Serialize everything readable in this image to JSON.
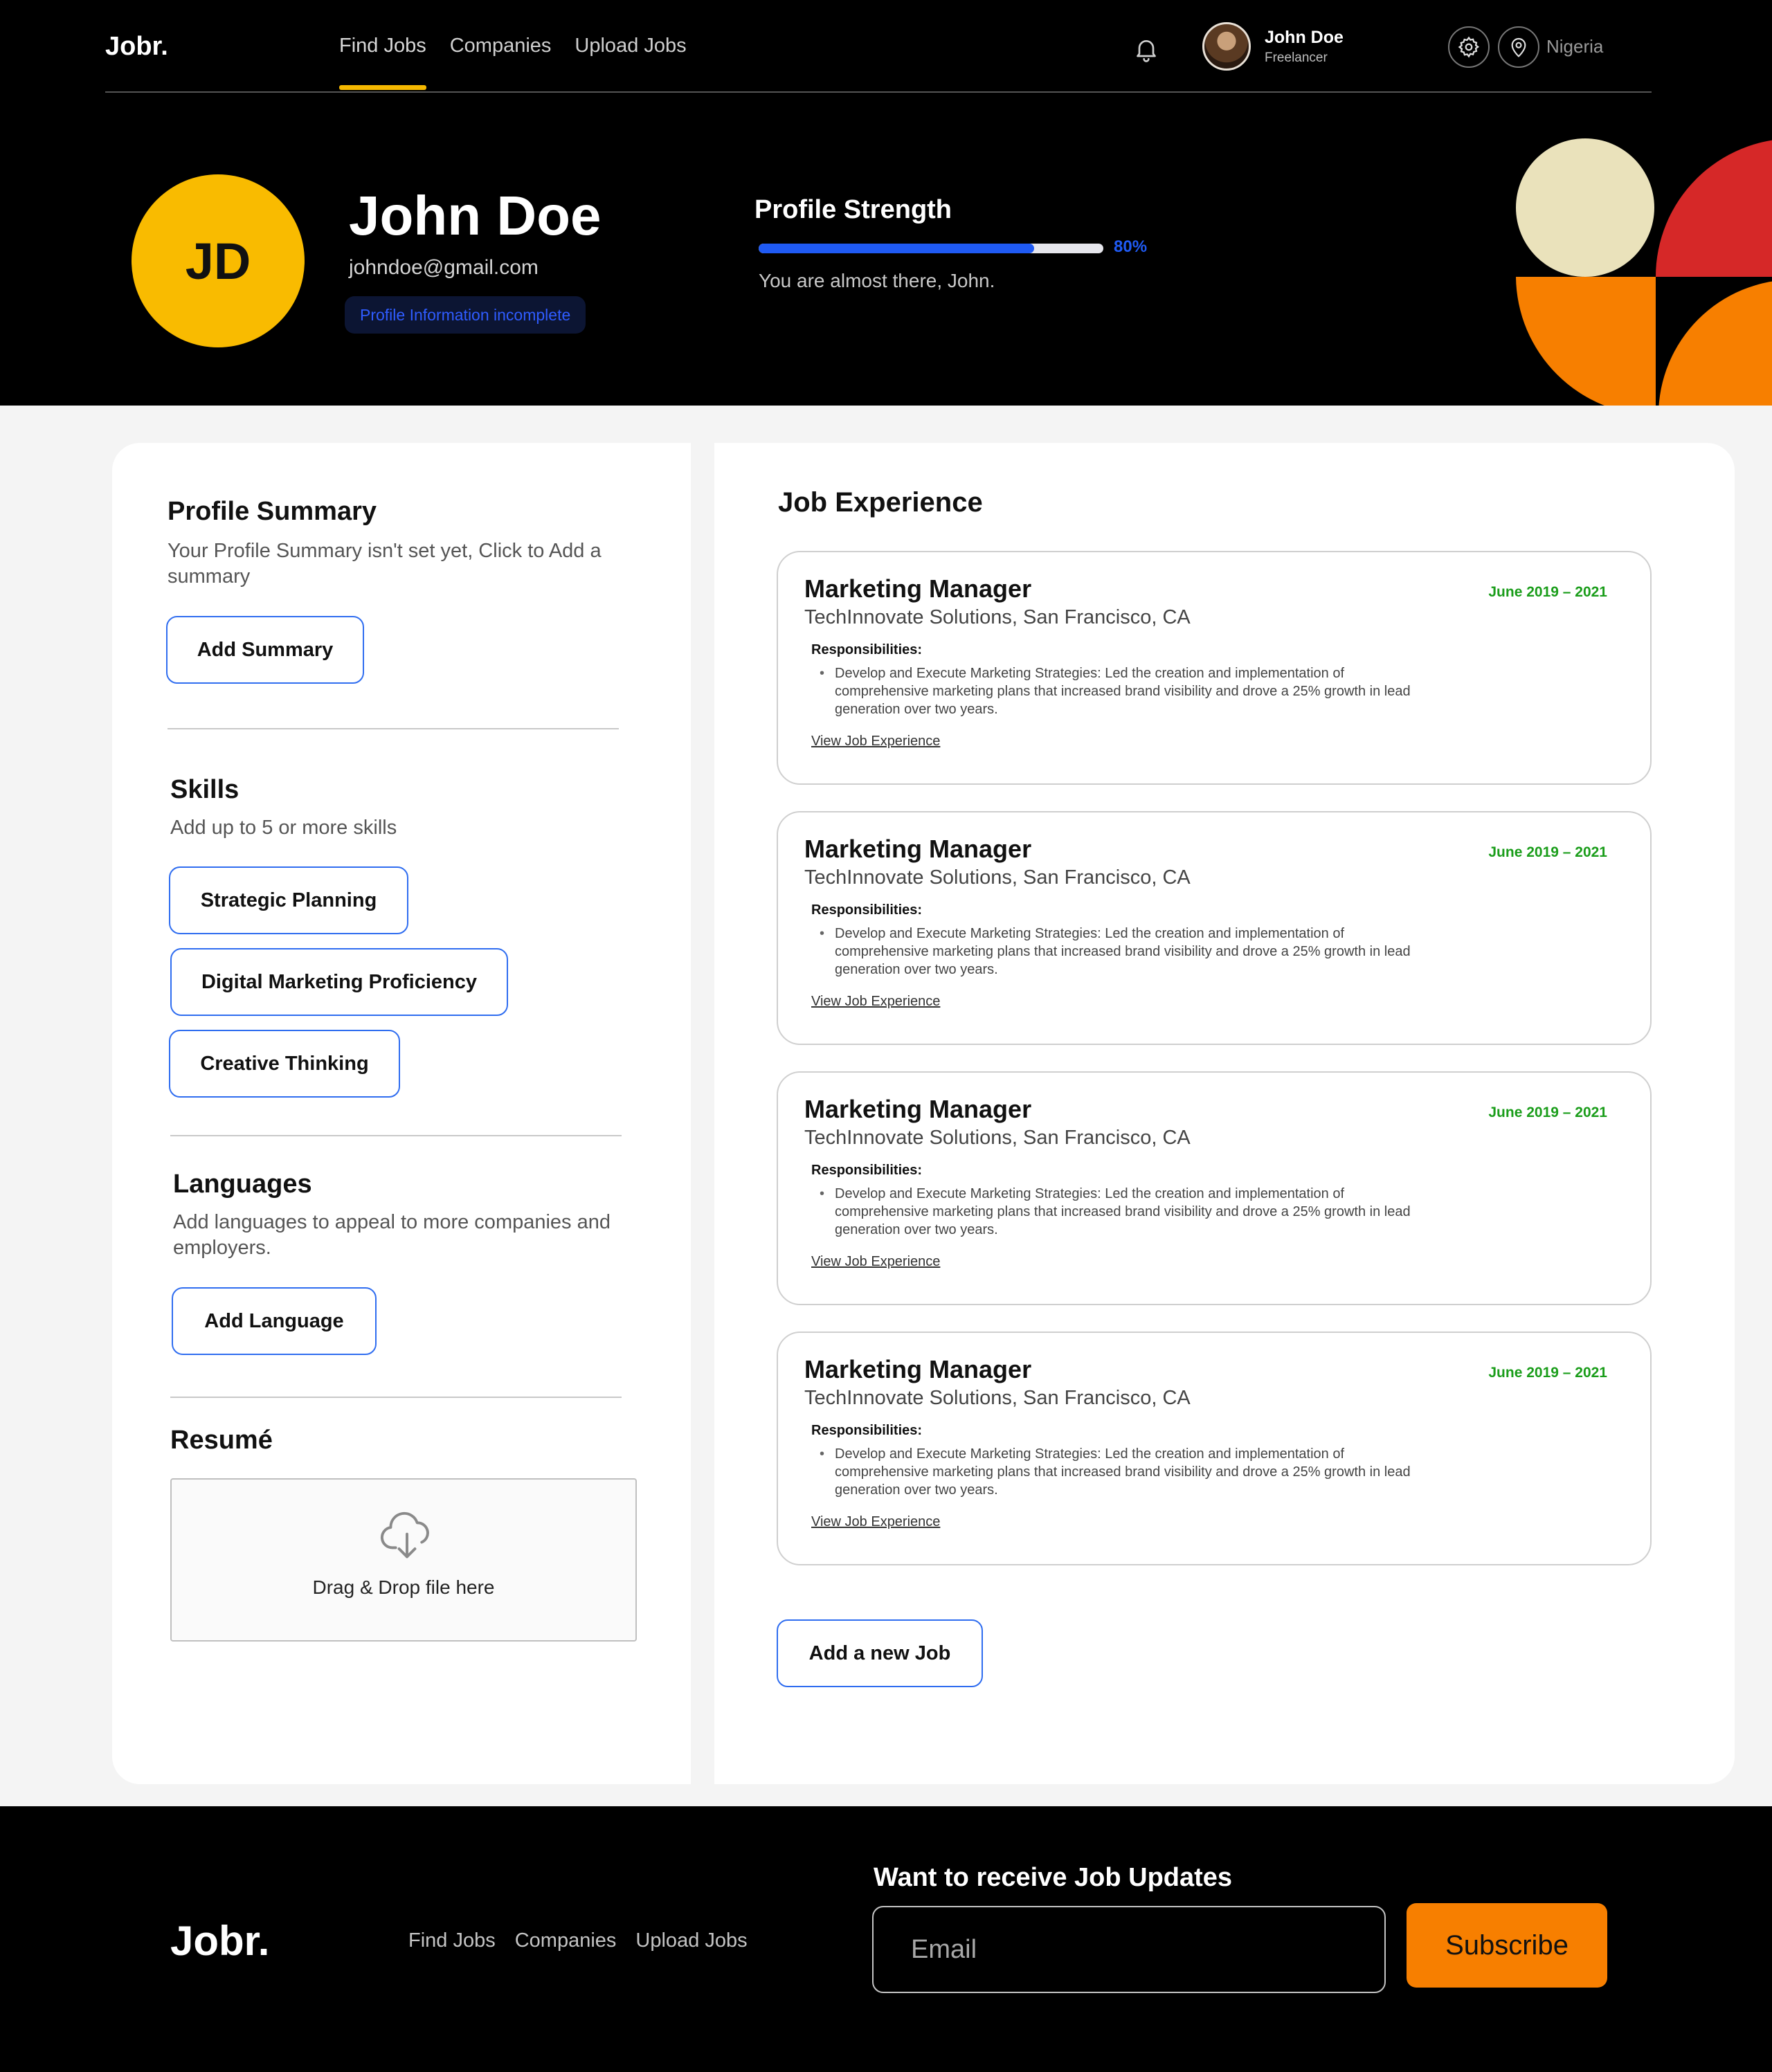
{
  "nav": {
    "logo": "Jobr.",
    "links": [
      "Find Jobs",
      "Companies",
      "Upload Jobs"
    ],
    "active_link": "Find Jobs",
    "user_name": "John Doe",
    "user_role": "Freelancer",
    "location": "Nigeria",
    "icons": [
      "bell-icon",
      "settings-icon",
      "location-pin-icon"
    ]
  },
  "profile": {
    "initials": "JD",
    "name": "John Doe",
    "email": "johndoe@gmail.com",
    "status_badge": "Profile Information incomplete",
    "strength_title": "Profile Strength",
    "strength_percent": 80,
    "strength_label": "80%",
    "strength_message": "You are almost there, John."
  },
  "sidebar": {
    "summary_title": "Profile Summary",
    "summary_desc": "Your Profile Summary isn't set yet, Click to Add a summary",
    "summary_button": "Add Summary",
    "skills_title": "Skills",
    "skills_desc": "Add up to 5 or more skills",
    "skills": [
      "Strategic Planning",
      "Digital Marketing Proficiency",
      "Creative Thinking"
    ],
    "languages_title": "Languages",
    "languages_desc": "Add languages to appeal to more companies and employers.",
    "languages_button": "Add Language",
    "resume_title": "Resumé",
    "resume_drop": "Drag & Drop file here"
  },
  "experience": {
    "title": "Job Experience",
    "jobs": [
      {
        "role": "Marketing Manager",
        "company": "TechInnovate Solutions, San Francisco, CA",
        "date": "June 2019 – 2021",
        "resp_label": "Responsibilities:",
        "desc": "Develop and Execute Marketing Strategies: Led the creation and implementation of comprehensive marketing plans that increased brand visibility and drove a 25% growth in lead generation over two years.",
        "link": "View Job Experience"
      },
      {
        "role": "Marketing Manager",
        "company": "TechInnovate Solutions, San Francisco, CA",
        "date": "June 2019 – 2021",
        "resp_label": "Responsibilities:",
        "desc": "Develop and Execute Marketing Strategies: Led the creation and implementation of comprehensive marketing plans that increased brand visibility and drove a 25% growth in lead generation over two years.",
        "link": "View Job Experience"
      },
      {
        "role": "Marketing Manager",
        "company": "TechInnovate Solutions, San Francisco, CA",
        "date": "June 2019 – 2021",
        "resp_label": "Responsibilities:",
        "desc": "Develop and Execute Marketing Strategies: Led the creation and implementation of comprehensive marketing plans that increased brand visibility and drove a 25% growth in lead generation over two years.",
        "link": "View Job Experience"
      },
      {
        "role": "Marketing Manager",
        "company": "TechInnovate Solutions, San Francisco, CA",
        "date": "June 2019 – 2021",
        "resp_label": "Responsibilities:",
        "desc": "Develop and Execute Marketing Strategies: Led the creation and implementation of comprehensive marketing plans that increased brand visibility and drove a 25% growth in lead generation over two years.",
        "link": "View Job Experience"
      }
    ],
    "add_button": "Add a new Job"
  },
  "footer": {
    "logo": "Jobr.",
    "links": [
      "Find Jobs",
      "Companies",
      "Upload Jobs"
    ],
    "newsletter_title": "Want to receive Job Updates",
    "email_placeholder": "Email",
    "subscribe_button": "Subscribe"
  },
  "colors": {
    "accent_yellow": "#f9bb00",
    "accent_orange": "#f77f00",
    "accent_red": "#d62828",
    "cream": "#eae2bb",
    "primary_blue": "#1f5af3",
    "date_green": "#1a9d1a"
  }
}
